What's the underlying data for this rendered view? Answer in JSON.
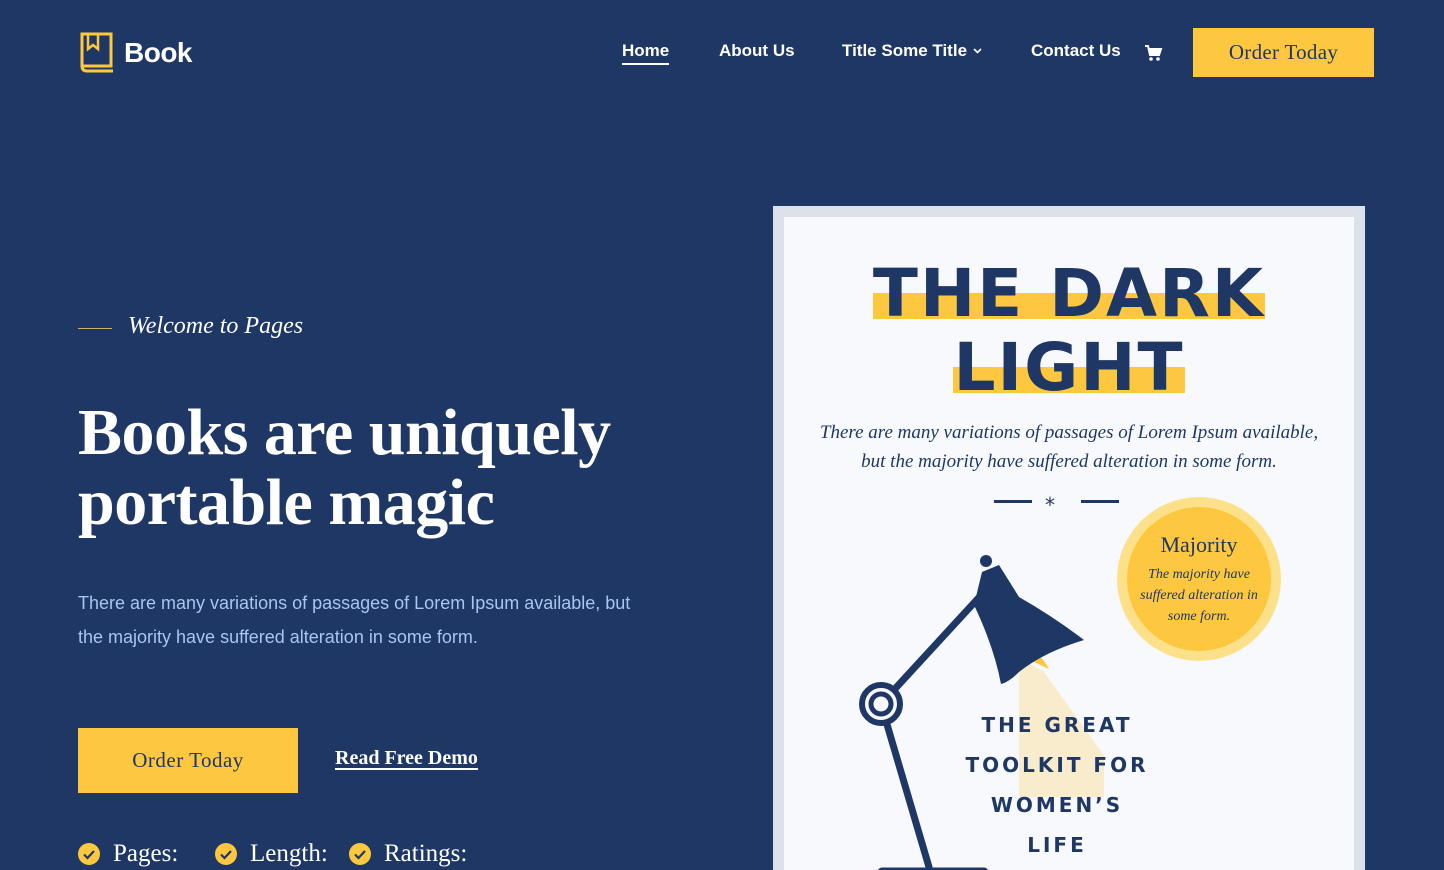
{
  "header": {
    "logo_text": "Book",
    "nav": {
      "home": "Home",
      "about": "About Us",
      "title": "Title Some Title",
      "contact": "Contact Us"
    },
    "order_label": "Order Today"
  },
  "hero": {
    "welcome": "Welcome to Pages",
    "headline_line1": "Books are uniquely",
    "headline_line2": "portable magic",
    "description": "There are many variations of passages of Lorem Ipsum available, but the majority have suffered alteration in some form.",
    "order_label": "Order Today",
    "demo_label": "Read Free Demo",
    "stats": {
      "pages": "Pages:",
      "length": "Length:",
      "ratings": "Ratings:"
    }
  },
  "cover": {
    "title_line1": "THE DARK",
    "title_line2": "LIGHT",
    "subtitle": "There are many variations of passages of Lorem Ipsum available, but the majority have suffered alteration in some form.",
    "divider_glyph": "*",
    "badge_title": "Majority",
    "badge_text": "The majority have suffered alteration in some form.",
    "tagline": "THE GREAT TOOLKIT FOR WOMEN’S LIFE"
  },
  "colors": {
    "background": "#1e3764",
    "accent": "#fdc83f",
    "body_text": "#a8c6ef",
    "cover_bg": "#f7f9fd"
  },
  "icons": [
    "book-logo-icon",
    "chevron-down-icon",
    "cart-icon",
    "check-circle-icon",
    "desk-lamp-icon"
  ]
}
